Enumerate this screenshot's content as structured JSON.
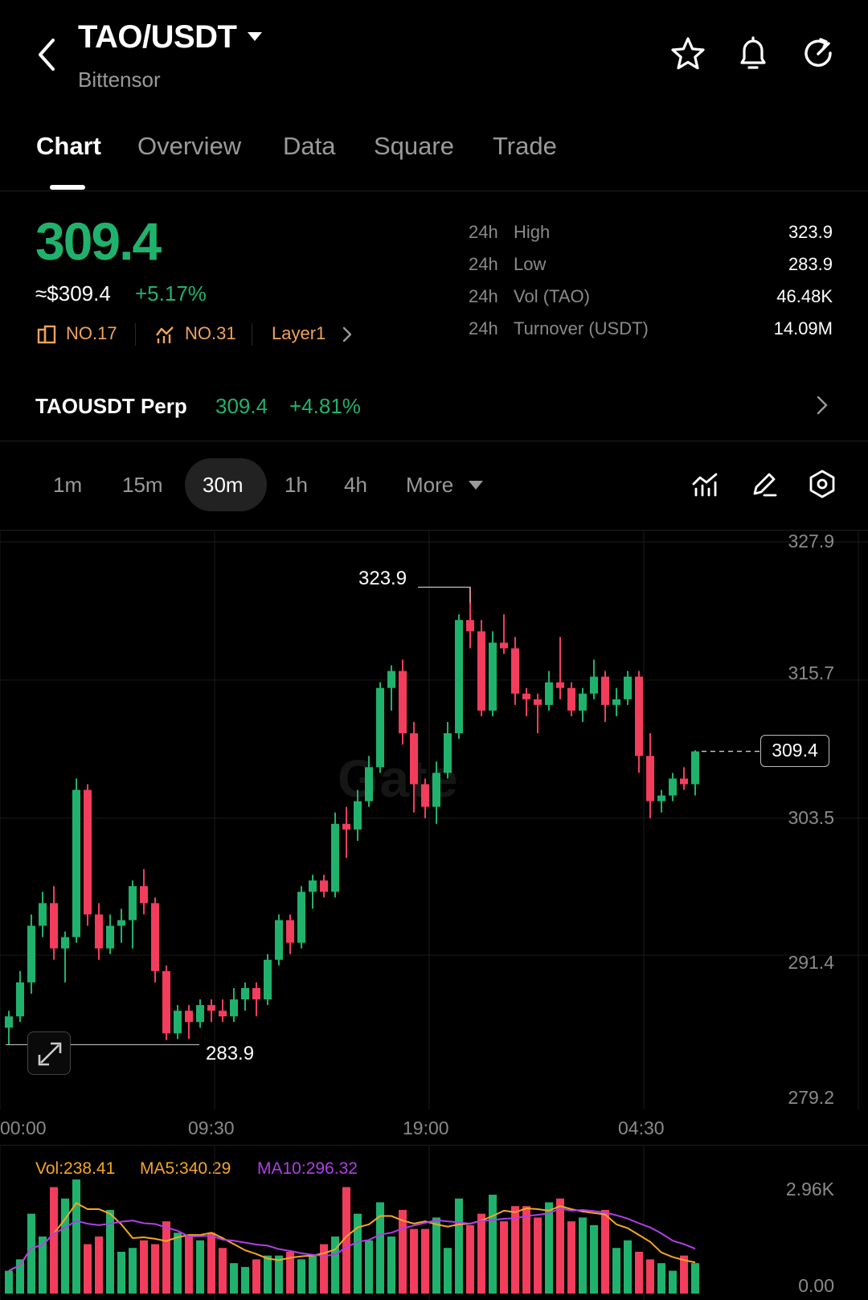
{
  "header": {
    "pair": "TAO/USDT",
    "name": "Bittensor"
  },
  "tabs": [
    "Chart",
    "Overview",
    "Data",
    "Square",
    "Trade"
  ],
  "price": {
    "last": "309.4",
    "usd": "≈$309.4",
    "change": "+5.17%",
    "rank_market_cap": "NO.17",
    "rank_trend": "NO.31",
    "category": "Layer1"
  },
  "stats": [
    {
      "period": "24h",
      "name": "High",
      "value": "323.9"
    },
    {
      "period": "24h",
      "name": "Low",
      "value": "283.9"
    },
    {
      "period": "24h",
      "name": "Vol (TAO)",
      "value": "46.48K"
    },
    {
      "period": "24h",
      "name": "Turnover (USDT)",
      "value": "14.09M"
    }
  ],
  "perp": {
    "name": "TAOUSDT Perp",
    "price": "309.4",
    "change": "+4.81%"
  },
  "intervals": [
    "1m",
    "15m",
    "30m",
    "1h",
    "4h",
    "More"
  ],
  "active_interval": "30m",
  "chart": {
    "watermark": "Gate",
    "price_axis": [
      "327.9",
      "315.7",
      "303.5",
      "291.4",
      "279.2"
    ],
    "time_axis": [
      "00:00",
      "09:30",
      "19:00",
      "04:30"
    ],
    "current_price": "309.4",
    "high_marker": "323.9",
    "low_marker": "283.9",
    "volume_labels": {
      "vol": "Vol:238.41",
      "ma5": "MA5:340.29",
      "ma10": "MA10:296.32"
    },
    "volume_axis": [
      "2.96K",
      "0.00"
    ]
  },
  "colors": {
    "up": "#20b26c",
    "down": "#f23d5c",
    "ma5": "#f5a623",
    "ma10": "#b13ee8",
    "accent": "#f0a35e"
  },
  "chart_data": {
    "type": "candlestick",
    "y_range": [
      279.2,
      327.9
    ],
    "candles": [
      [
        285.0,
        286.5,
        283.5,
        286.0
      ],
      [
        286.0,
        290.0,
        285.5,
        289.0
      ],
      [
        289.0,
        295.0,
        288.0,
        294.0
      ],
      [
        294.0,
        297.0,
        293.0,
        296.0
      ],
      [
        296.0,
        297.5,
        291.0,
        292.0
      ],
      [
        292.0,
        293.5,
        289.0,
        293.0
      ],
      [
        293.0,
        307.0,
        292.5,
        306.0
      ],
      [
        306.0,
        306.5,
        294.0,
        295.0
      ],
      [
        295.0,
        296.0,
        291.0,
        292.0
      ],
      [
        292.0,
        295.0,
        291.5,
        294.0
      ],
      [
        294.0,
        295.5,
        292.5,
        294.5
      ],
      [
        294.5,
        298.0,
        292.0,
        297.5
      ],
      [
        297.5,
        299.0,
        295.0,
        296.0
      ],
      [
        296.0,
        296.5,
        289.0,
        290.0
      ],
      [
        290.0,
        290.5,
        283.9,
        284.5
      ],
      [
        284.5,
        287.0,
        284.0,
        286.5
      ],
      [
        286.5,
        287.0,
        284.0,
        285.5
      ],
      [
        285.5,
        287.5,
        285.0,
        287.0
      ],
      [
        287.0,
        287.5,
        285.5,
        286.5
      ],
      [
        286.5,
        287.5,
        285.5,
        286.0
      ],
      [
        286.0,
        288.5,
        285.5,
        287.5
      ],
      [
        287.5,
        289.0,
        286.5,
        288.5
      ],
      [
        288.5,
        289.0,
        286.0,
        287.5
      ],
      [
        287.5,
        291.5,
        287.0,
        291.0
      ],
      [
        291.0,
        295.0,
        290.5,
        294.5
      ],
      [
        294.5,
        295.0,
        291.5,
        292.5
      ],
      [
        292.5,
        297.5,
        292.0,
        297.0
      ],
      [
        297.0,
        298.5,
        295.5,
        298.0
      ],
      [
        298.0,
        298.5,
        296.5,
        297.0
      ],
      [
        297.0,
        304.0,
        296.5,
        303.0
      ],
      [
        303.0,
        304.5,
        300.0,
        302.5
      ],
      [
        302.5,
        306.0,
        301.5,
        305.0
      ],
      [
        305.0,
        309.0,
        304.5,
        308.0
      ],
      [
        308.0,
        315.5,
        307.5,
        315.0
      ],
      [
        315.0,
        317.0,
        313.0,
        316.5
      ],
      [
        316.5,
        317.5,
        310.0,
        311.0
      ],
      [
        311.0,
        312.0,
        304.0,
        306.5
      ],
      [
        306.5,
        307.0,
        303.5,
        304.5
      ],
      [
        304.5,
        308.5,
        303.0,
        307.5
      ],
      [
        307.5,
        312.0,
        307.0,
        311.0
      ],
      [
        311.0,
        321.5,
        310.5,
        321.0
      ],
      [
        321.0,
        323.9,
        318.5,
        320.0
      ],
      [
        320.0,
        321.0,
        312.5,
        313.0
      ],
      [
        313.0,
        320.0,
        312.5,
        319.0
      ],
      [
        319.0,
        321.5,
        318.0,
        318.5
      ],
      [
        318.5,
        319.5,
        313.5,
        314.5
      ],
      [
        314.5,
        315.0,
        312.5,
        314.0
      ],
      [
        314.0,
        314.5,
        311.0,
        313.5
      ],
      [
        313.5,
        316.5,
        313.0,
        315.5
      ],
      [
        315.5,
        319.5,
        314.0,
        315.0
      ],
      [
        315.0,
        315.5,
        312.5,
        313.0
      ],
      [
        313.0,
        315.0,
        312.0,
        314.5
      ],
      [
        314.5,
        317.5,
        314.0,
        316.0
      ],
      [
        316.0,
        316.5,
        312.0,
        313.5
      ],
      [
        313.5,
        315.0,
        312.5,
        314.0
      ],
      [
        314.0,
        316.5,
        313.5,
        316.0
      ],
      [
        316.0,
        316.5,
        307.5,
        309.0
      ],
      [
        309.0,
        311.0,
        303.5,
        305.0
      ],
      [
        305.0,
        306.0,
        304.0,
        305.5
      ],
      [
        305.5,
        307.5,
        305.0,
        307.0
      ],
      [
        307.0,
        308.0,
        306.0,
        306.5
      ],
      [
        306.5,
        309.5,
        305.5,
        309.4
      ]
    ],
    "volume_max": 2960,
    "volumes": [
      600,
      900,
      2100,
      1500,
      2800,
      2500,
      3000,
      1300,
      1500,
      2200,
      1100,
      1200,
      1400,
      1300,
      1900,
      1600,
      1500,
      1400,
      1600,
      1200,
      800,
      700,
      900,
      1000,
      1000,
      1100,
      900,
      1000,
      1300,
      1500,
      2800,
      2100,
      1400,
      2400,
      1500,
      2200,
      1700,
      1700,
      2000,
      1200,
      2500,
      1800,
      2100,
      2600,
      1900,
      2300,
      2300,
      2000,
      2400,
      2500,
      1900,
      2000,
      1800,
      2200,
      1200,
      1400,
      1100,
      900,
      800,
      600,
      1000,
      800
    ]
  }
}
